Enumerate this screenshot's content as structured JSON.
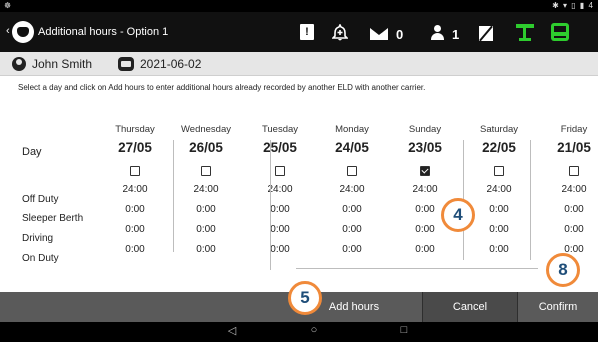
{
  "status_bar": {
    "left_glyph": "☸",
    "right_glyphs": "✱ ▾ ▯ ▮ 4"
  },
  "app_bar": {
    "title": "Additional hours - Option 1",
    "messages_count": "0",
    "users_count": "1",
    "icons": [
      "back-icon",
      "app-logo-icon",
      "alert-icon",
      "bell-icon",
      "mail-icon",
      "person-icon",
      "no-signal-icon",
      "network-icon",
      "truck-icon"
    ],
    "accent_green": "#2ecc2e"
  },
  "driver": {
    "name": "John Smith",
    "date": "2021-06-02"
  },
  "instruction": "Select a day and click on Add hours to enter additional hours already recorded by another ELD with another carrier.",
  "table": {
    "row_labels": [
      "Day",
      "Off Duty",
      "Sleeper Berth",
      "Driving",
      "On Duty"
    ],
    "columns": [
      {
        "weekday": "Thursday",
        "date": "27/05",
        "checked": false,
        "values": [
          "24:00",
          "0:00",
          "0:00",
          "0:00"
        ]
      },
      {
        "weekday": "Wednesday",
        "date": "26/05",
        "checked": false,
        "values": [
          "24:00",
          "0:00",
          "0:00",
          "0:00"
        ]
      },
      {
        "weekday": "Tuesday",
        "date": "25/05",
        "checked": false,
        "values": [
          "24:00",
          "0:00",
          "0:00",
          "0:00"
        ]
      },
      {
        "weekday": "Monday",
        "date": "24/05",
        "checked": false,
        "values": [
          "24:00",
          "0:00",
          "0:00",
          "0:00"
        ]
      },
      {
        "weekday": "Sunday",
        "date": "23/05",
        "checked": true,
        "values": [
          "24:00",
          "0:00",
          "0:00",
          "0:00"
        ]
      },
      {
        "weekday": "Saturday",
        "date": "22/05",
        "checked": false,
        "values": [
          "24:00",
          "0:00",
          "0:00",
          "0:00"
        ]
      },
      {
        "weekday": "Friday",
        "date": "21/05",
        "checked": false,
        "values": [
          "24:00",
          "0:00",
          "0:00",
          "0:00"
        ]
      }
    ]
  },
  "actions": {
    "add_hours": "Add hours",
    "cancel": "Cancel",
    "confirm": "Confirm"
  },
  "nav_bar": {
    "back": "◁",
    "home": "○",
    "recents": "□"
  },
  "callouts": {
    "step_a": "4",
    "step_b": "5",
    "step_c": "8",
    "color": "#f08a3a"
  }
}
